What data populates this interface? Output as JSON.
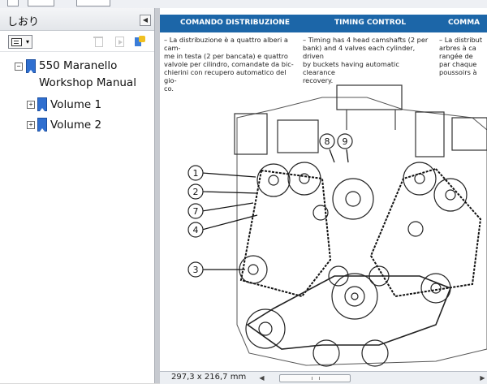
{
  "panel": {
    "title": "しおり",
    "collapse_icon": "chevron-left-icon",
    "toolbar": {
      "options_icon": "list-options-icon",
      "delete_icon": "trash-icon",
      "expand_icon": "expand-bookmark-icon",
      "new_bookmark_icon": "new-bookmark-icon"
    },
    "tree": {
      "root": {
        "toggle": "−",
        "line1": "550 Maranello",
        "line2": "Workshop Manual"
      },
      "children": [
        {
          "toggle": "+",
          "label": "Volume 1"
        },
        {
          "toggle": "+",
          "label": "Volume 2"
        }
      ]
    }
  },
  "document": {
    "header": {
      "italian": "COMANDO DISTRIBUZIONE",
      "english": "TIMING CONTROL",
      "french": "COMMA"
    },
    "columns": {
      "italian": [
        "– La distribuzione è a quattro alberi a cam-",
        "me in testa (2 per bancata) e quattro",
        "valvole per cilindro, comandate da bic-",
        "chierini con recupero automatico del gio-",
        "co."
      ],
      "english": [
        "– Timing has 4 head camshafts (2 per",
        "bank) and 4 valves each cylinder, driven",
        "by buckets having automatic clearance",
        "recovery."
      ],
      "french": [
        "– La distribut",
        "arbres à ca",
        "rangée de",
        "par chaque",
        "poussoirs à"
      ]
    },
    "callouts": [
      "1",
      "2",
      "7",
      "4",
      "3",
      "8",
      "9"
    ]
  },
  "status": {
    "page_size": "297,3 x 216,7 mm",
    "scroll_left_icon": "scroll-left-arrow-icon",
    "scroll_right_icon": "scroll-right-arrow-icon"
  },
  "colors": {
    "header_blue": "#1c66a8",
    "bookmark_blue": "#2f6fd0"
  }
}
